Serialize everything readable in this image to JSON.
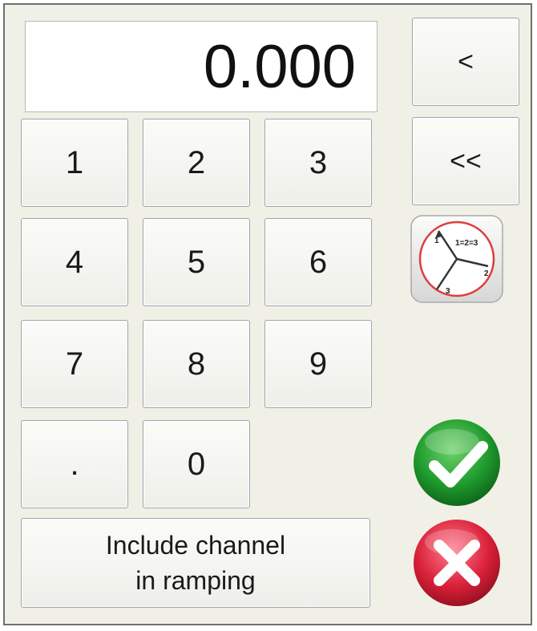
{
  "display": {
    "value": "0.000"
  },
  "keypad": {
    "k1": "1",
    "k2": "2",
    "k3": "3",
    "k4": "4",
    "k5": "5",
    "k6": "6",
    "k7": "7",
    "k8": "8",
    "k9": "9",
    "dot": ".",
    "k0": "0"
  },
  "side": {
    "backspace_label": "<",
    "clear_label": "<<"
  },
  "phase_icon": {
    "label": "1=2=3",
    "n1": "1",
    "n2": "2",
    "n3": "3"
  },
  "ramping": {
    "line1": "Include channel",
    "line2": "in ramping"
  },
  "colors": {
    "panel_bg": "#f1f0e6",
    "ok_green": "#1e9a2d",
    "cancel_red": "#d92139"
  },
  "icons": {
    "ok": "check-icon",
    "cancel": "x-icon",
    "phase": "three-phase-icon"
  }
}
